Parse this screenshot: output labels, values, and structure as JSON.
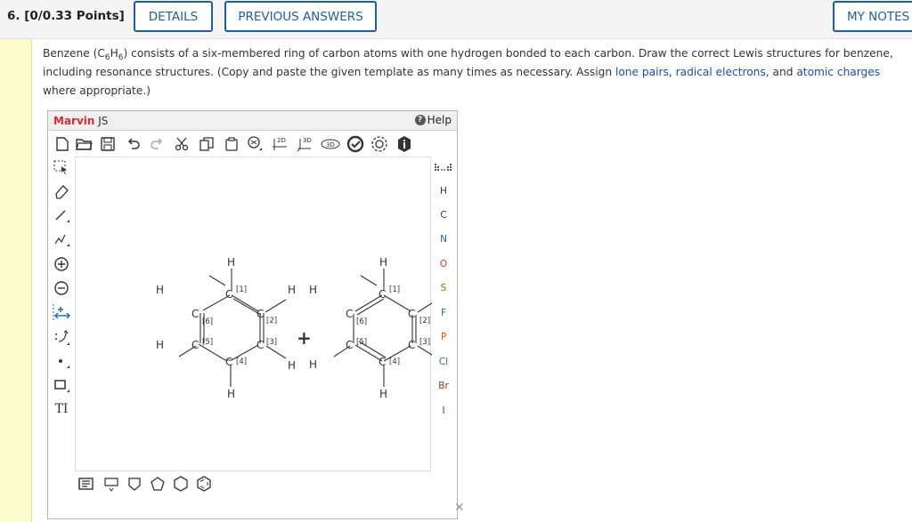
{
  "header": {
    "question_title": "6.  [0/0.33 Points]",
    "details_label": "DETAILS",
    "previous_answers_label": "PREVIOUS ANSWERS",
    "my_notes_label": "MY NOTES"
  },
  "question": {
    "p1": "Benzene (C",
    "sub1": "6",
    "p2": "H",
    "sub2": "6",
    "p3": ") consists of a six-membered ring of carbon atoms with one hydrogen bonded to each carbon. Draw the correct Lewis structures for benzene, including resonance structures. (Copy and paste the given template as many times as necessary. Assign ",
    "link1": "lone pairs",
    "sep1": ", ",
    "link2": "radical electrons",
    "sep2": ", and ",
    "link3": "atomic charges",
    "p4": " where appropriate.)"
  },
  "marvin": {
    "brand": "Marvin",
    "brand_suffix": " JS",
    "help_label": "Help",
    "toolbar_top": [
      "new-document",
      "open-file",
      "save",
      "undo",
      "redo",
      "cut",
      "copy",
      "paste",
      "zoom",
      "2D",
      "3D",
      "3D-view",
      "clean",
      "settings",
      "info"
    ],
    "label_2d": "2D",
    "label_3d": "3D",
    "label_3dv": "3D",
    "elements": [
      "H",
      "C",
      "N",
      "O",
      "S",
      "F",
      "P",
      "Cl",
      "Br",
      "I"
    ],
    "element_colors": {
      "H": "#333333",
      "C": "#333333",
      "N": "#1565c0",
      "O": "#d32f2f",
      "S": "#8d6e00",
      "F": "#2e7d32",
      "P": "#d35400",
      "Cl": "#2e7d32",
      "Br": "#8b3a1a",
      "I": "#6a1b9a"
    },
    "tt_label": "TI",
    "molecule": {
      "plus": "+",
      "atom_labels": [
        "H",
        "C",
        "[1]",
        "[2]",
        "[3]",
        "[4]",
        "[5]",
        "[6]"
      ]
    }
  }
}
